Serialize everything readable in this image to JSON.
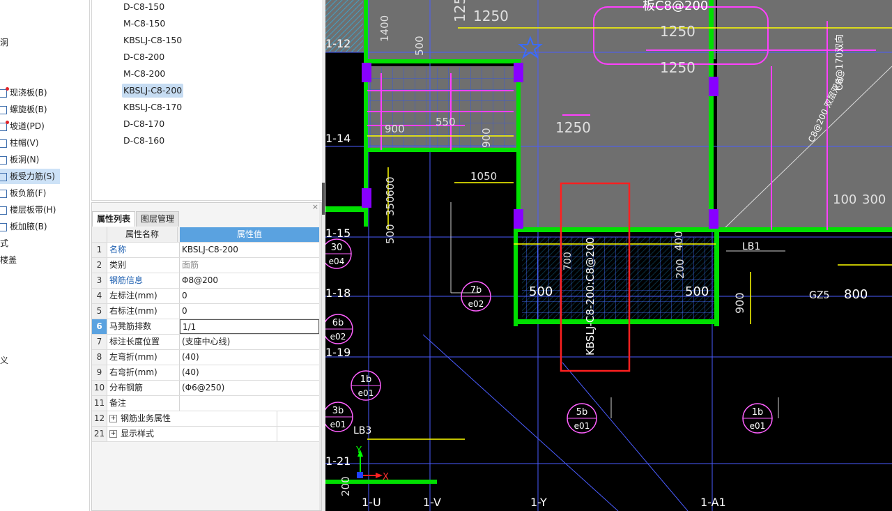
{
  "nav": {
    "items": [
      {
        "label": "洞",
        "badge": false
      },
      {
        "label": "现浇板(B)",
        "badge": true
      },
      {
        "label": "螺旋板(B)",
        "badge": false
      },
      {
        "label": "坡道(PD)",
        "badge": true
      },
      {
        "label": "柱帽(V)",
        "badge": false
      },
      {
        "label": "板洞(N)",
        "badge": false
      },
      {
        "label": "板受力筋(S)",
        "badge": false,
        "selected": true
      },
      {
        "label": "板负筋(F)",
        "badge": false
      },
      {
        "label": "楼层板带(H)",
        "badge": false
      },
      {
        "label": "板加腋(B)",
        "badge": false
      },
      {
        "label": "式",
        "badge": false
      },
      {
        "label": "楼盖",
        "badge": false
      },
      {
        "label": "义",
        "badge": false
      }
    ]
  },
  "components": {
    "items": [
      "D-C8-150",
      "M-C8-150",
      "KBSLJ-C8-150",
      "D-C8-200",
      "M-C8-200",
      "KBSLJ-C8-200",
      "KBSLJ-C8-170",
      "D-C8-170",
      "D-C8-160"
    ],
    "selected_index": 5
  },
  "panel": {
    "close": "×",
    "tabs": [
      "属性列表",
      "图层管理"
    ],
    "header": {
      "name": "属性名称",
      "value": "属性值"
    },
    "rows": [
      {
        "num": "1",
        "name": "名称",
        "value": "KBSLJ-C8-200",
        "blue": true
      },
      {
        "num": "2",
        "name": "类别",
        "value": "面筋",
        "grey": true
      },
      {
        "num": "3",
        "name": "钢筋信息",
        "value": "Φ8@200",
        "blue": true
      },
      {
        "num": "4",
        "name": "左标注(mm)",
        "value": "0"
      },
      {
        "num": "5",
        "name": "右标注(mm)",
        "value": "0"
      },
      {
        "num": "6",
        "name": "马凳筋排数",
        "value": "1/1",
        "selected": true
      },
      {
        "num": "7",
        "name": "标注长度位置",
        "value": "(支座中心线)"
      },
      {
        "num": "8",
        "name": "左弯折(mm)",
        "value": "(40)"
      },
      {
        "num": "9",
        "name": "右弯折(mm)",
        "value": "(40)"
      },
      {
        "num": "10",
        "name": "分布钢筋",
        "value": "(Φ6@250)"
      },
      {
        "num": "11",
        "name": "备注",
        "value": ""
      },
      {
        "num": "12",
        "name": "钢筋业务属性",
        "value": "",
        "expand": true
      },
      {
        "num": "21",
        "name": "显示样式",
        "value": "",
        "expand": true
      }
    ]
  },
  "cad": {
    "axes": [
      "1-12",
      "1-14",
      "1-15",
      "1-18",
      "1-19",
      "1-21",
      "1-U",
      "1-V",
      "1-Y",
      "1-A1"
    ],
    "dims": [
      "1250",
      "1250",
      "1250",
      "1250",
      "1250",
      "1400",
      "500",
      "900",
      "550",
      "900",
      "1050",
      "600",
      "350",
      "500",
      "500",
      "500",
      "700",
      "400",
      "200",
      "900",
      "100",
      "300",
      "800",
      "200"
    ],
    "labels": [
      "板C8@200",
      "C8@170双向",
      "C8@200 双层双向",
      "KBSLJ-C8-200:C8@200",
      "LB1",
      "LB3",
      "GZ5"
    ],
    "bubbles": [
      {
        "top": "30",
        "bottom": "e04"
      },
      {
        "top": "7b",
        "bottom": "e02"
      },
      {
        "top": "6b",
        "bottom": "e02"
      },
      {
        "top": "1b",
        "bottom": "e01"
      },
      {
        "top": "3b",
        "bottom": "e01"
      },
      {
        "top": "5b",
        "bottom": "e01"
      },
      {
        "top": "1b",
        "bottom": "e01"
      }
    ],
    "ucs": {
      "x": "X",
      "y": "Y"
    },
    "colors": {
      "bg": "#000000",
      "slab": "#6f6f6f",
      "beam": "#00ff00",
      "dim": "#ffff00",
      "rebar": "#ff40ff",
      "grid": "#4060ff",
      "highlight": "#ff2020"
    }
  }
}
